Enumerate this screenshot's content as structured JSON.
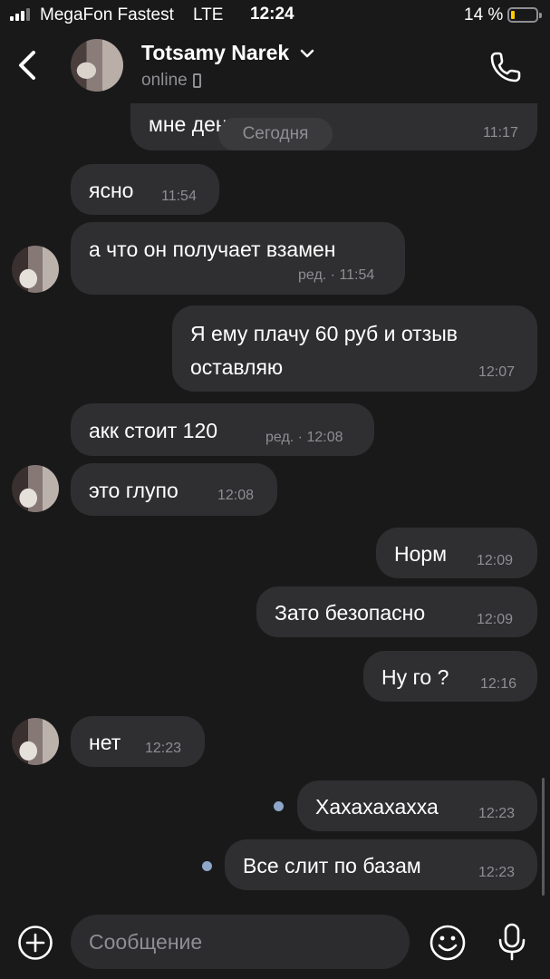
{
  "status_bar": {
    "carrier": "MegaFon Fastest",
    "network": "LTE",
    "time": "12:24",
    "battery": "14 %",
    "battery_level": 0.14
  },
  "header": {
    "contact_name": "Totsamy Narek",
    "status": "online"
  },
  "date_separator": "Сегодня",
  "messages": [
    {
      "dir": "in",
      "text": "мне деньги",
      "time": "11:17"
    },
    {
      "dir": "in",
      "text": "ясно",
      "time": "11:54"
    },
    {
      "dir": "in",
      "text": "а что он получает взамен",
      "time": "ред. · 11:54"
    },
    {
      "dir": "out",
      "text": "Я ему плачу 60 руб и отзыв",
      "text2": "оставляю",
      "time": "12:07"
    },
    {
      "dir": "in",
      "text": "акк стоит 120",
      "time": "ред. · 12:08"
    },
    {
      "dir": "in",
      "text": "это глупо",
      "time": "12:08"
    },
    {
      "dir": "out",
      "text": "Норм",
      "time": "12:09"
    },
    {
      "dir": "out",
      "text": "Зато безопасно",
      "time": "12:09"
    },
    {
      "dir": "out",
      "text": "Ну го ?",
      "time": "12:16"
    },
    {
      "dir": "in",
      "text": "нет",
      "time": "12:23"
    },
    {
      "dir": "out",
      "text": "Хахахахахха",
      "time": "12:23",
      "unread": true
    },
    {
      "dir": "out",
      "text": "Все слит по базам",
      "time": "12:23",
      "unread": true
    }
  ],
  "composer": {
    "placeholder": "Сообщение"
  },
  "colors": {
    "background": "#19191a",
    "bubble": "#2f2f31",
    "secondary_text": "#8e8e93",
    "unread_dot": "#8ea6c9",
    "battery_fill": "#ffcc00"
  },
  "icons": [
    "back-icon",
    "chevron-down-icon",
    "phone-icon",
    "plus-icon",
    "emoji-icon",
    "microphone-icon"
  ]
}
